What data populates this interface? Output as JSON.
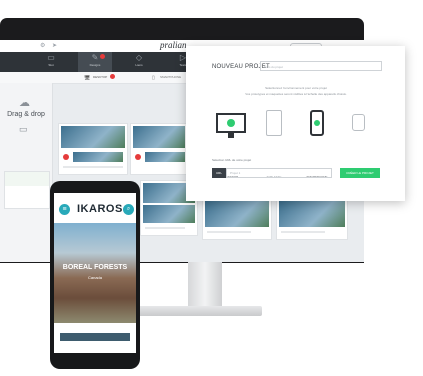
{
  "app": {
    "logo": "pralian"
  },
  "toolbar": {
    "tools": [
      {
        "label": "Slot",
        "icon": "tablet-icon"
      },
      {
        "label": "Designs",
        "icon": "brush-icon",
        "active": true
      },
      {
        "label": "Liens",
        "icon": "tag-icon"
      },
      {
        "label": "Tests",
        "icon": "play-icon"
      }
    ]
  },
  "subbar": {
    "desktop_label": "DESKTOP",
    "smartphone_label": "SMARTPHONE"
  },
  "left_panel": {
    "drag_drop": "Drag & drop"
  },
  "modal": {
    "title": "NOUVEAU PROJET",
    "name_placeholder": "Nom du projet",
    "description_line1": "Sélectionnez l'environnement pour votre projet",
    "description_line2": "Vos prototypes et maquettes seront visibles à l'échelle des appareils choisis.",
    "devices": [
      {
        "label": "DESKTOP",
        "selected": true
      },
      {
        "label": "TABLETTE",
        "selected": false
      },
      {
        "label": "SMARTPHONE",
        "selected": true
      },
      {
        "label": "SMARTWATCH",
        "selected": false
      }
    ],
    "url_label": "Sélection URL de votre projet",
    "url_prefix": "URL",
    "url_placeholder": "Projet 1",
    "create_button": "CRÉER LE PROJET",
    "accent": "#2ecc71"
  },
  "phone": {
    "brand": "IKAROS",
    "hero_title": "BOREAL FORESTS",
    "hero_subtitle": "Canada",
    "accent": "#28a9b9"
  }
}
